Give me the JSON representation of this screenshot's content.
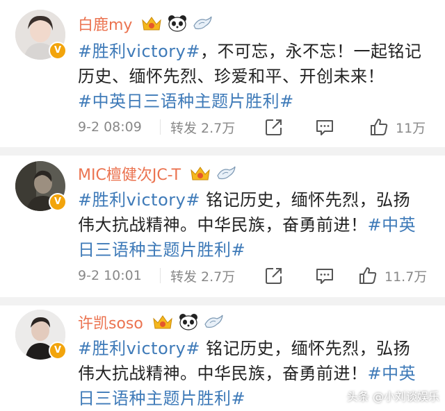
{
  "posts": [
    {
      "author": "白鹿my",
      "text_segments": [
        {
          "text": "#胜利victory#",
          "tag": true
        },
        {
          "text": "，不可忘，永不忘！一起铭记历史、缅怀先烈、珍爱和平、开创未来！",
          "tag": false
        },
        {
          "text": "#中英日三语种主题片胜利#",
          "tag": true
        }
      ],
      "time": "9-2 08:09",
      "repost": "转发 2.7万",
      "likes": "11万",
      "badges": [
        "crown-badge",
        "panda-badge",
        "bird-badge"
      ]
    },
    {
      "author": "MIC檀健次JC-T",
      "text_segments": [
        {
          "text": "#胜利victory#",
          "tag": true
        },
        {
          "text": " 铭记历史，缅怀先烈，弘扬伟大抗战精神。中华民族，奋勇前进！",
          "tag": false
        },
        {
          "text": "#中英日三语种主题片胜利#",
          "tag": true
        }
      ],
      "time": "9-2 10:01",
      "repost": "转发 2.7万",
      "likes": "11.7万",
      "badges": [
        "crown-badge",
        "bird-badge"
      ]
    },
    {
      "author": "许凯soso",
      "text_segments": [
        {
          "text": "#胜利victory#",
          "tag": true
        },
        {
          "text": " 铭记历史，缅怀先烈，弘扬伟大抗战精神。中华民族，奋勇前进！",
          "tag": false
        },
        {
          "text": "#中英日三语种主题片胜利#",
          "tag": true
        }
      ],
      "badges": [
        "crown-badge",
        "panda-badge",
        "bird-badge"
      ]
    }
  ],
  "verified_mark": "V",
  "watermark": "头条 @小刘谈娱乐",
  "colors": {
    "name": "#eb7350",
    "tag": "#3e7ab8",
    "verified": "#f2a40c"
  }
}
